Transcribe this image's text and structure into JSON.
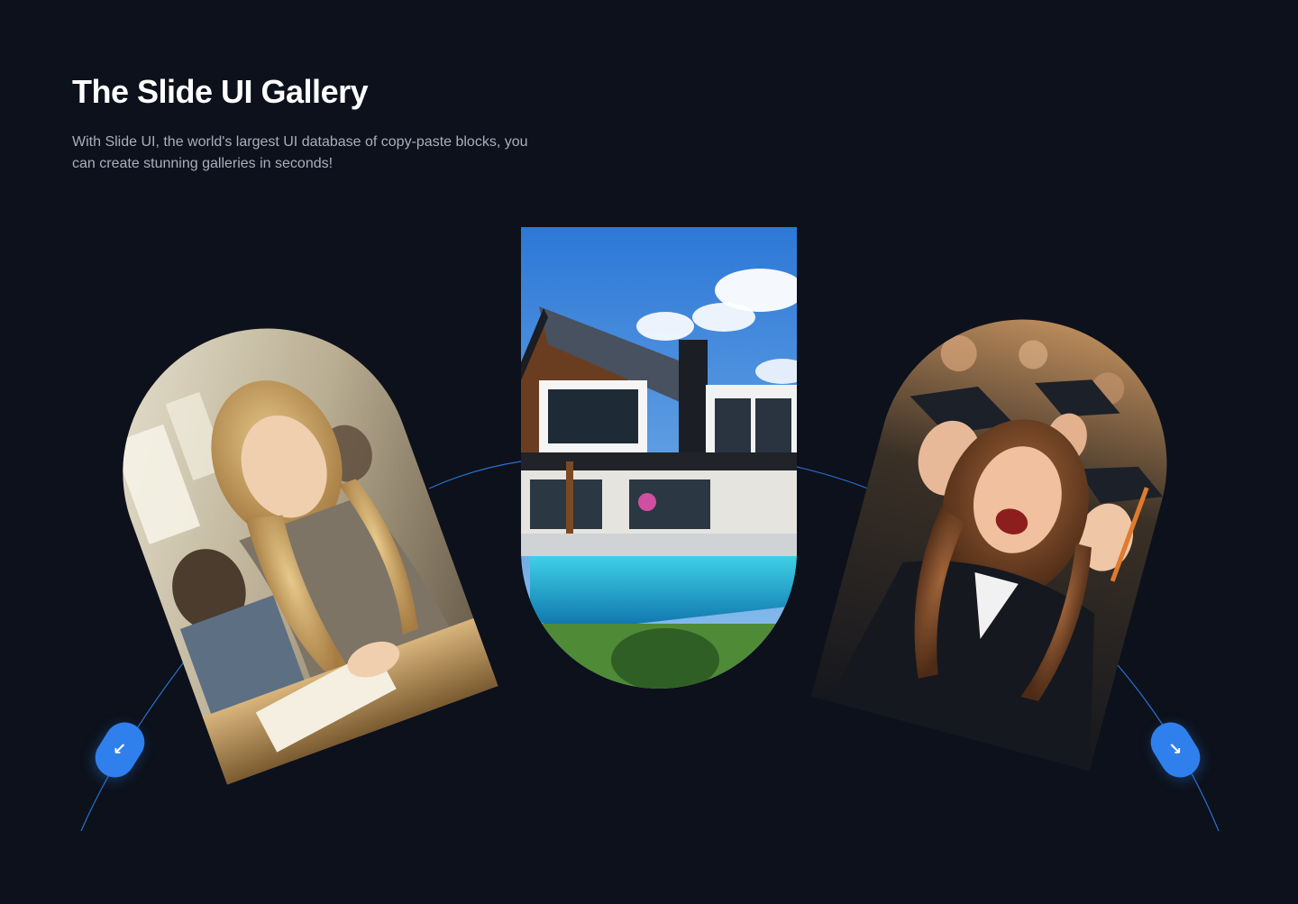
{
  "header": {
    "title": "The Slide UI Gallery",
    "subtitle": "With Slide UI, the world's largest UI database of copy-paste blocks, you can create stunning galleries in seconds!"
  },
  "gallery": {
    "slides": [
      {
        "name": "student-in-classroom-image",
        "subject": "student-in-classroom"
      },
      {
        "name": "modern-house-with-pool-image",
        "subject": "modern-house-with-pool"
      },
      {
        "name": "graduates-celebrating-image",
        "subject": "graduates-celebrating"
      }
    ],
    "controls": {
      "prev_icon": "arrow-down-left-icon",
      "next_icon": "arrow-down-right-icon",
      "prev_glyph": "↙",
      "next_glyph": "↘"
    }
  },
  "colors": {
    "background": "#0d111b",
    "accent": "#2f80ed",
    "arc": "#2f80ed",
    "subtitle_text": "#a7afbe"
  }
}
